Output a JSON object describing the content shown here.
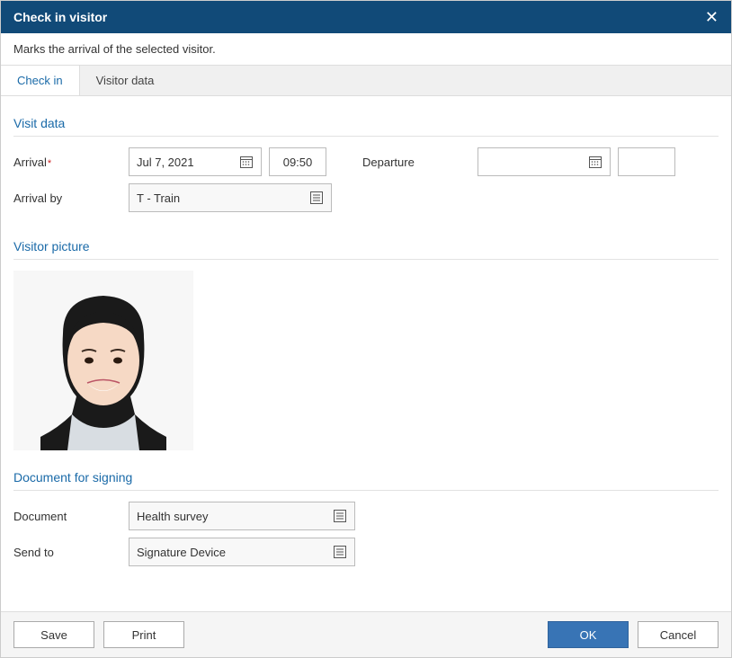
{
  "dialog": {
    "title": "Check in visitor",
    "subtitle": "Marks the arrival of the selected visitor."
  },
  "tabs": [
    {
      "label": "Check in",
      "active": true
    },
    {
      "label": "Visitor data",
      "active": false
    }
  ],
  "sections": {
    "visit_data": {
      "title": "Visit data"
    },
    "visitor_picture": {
      "title": "Visitor picture"
    },
    "document_signing": {
      "title": "Document for signing"
    }
  },
  "fields": {
    "arrival": {
      "label": "Arrival",
      "required": true,
      "date": "Jul 7, 2021",
      "time": "09:50"
    },
    "departure": {
      "label": "Departure",
      "date": "",
      "time": ""
    },
    "arrival_by": {
      "label": "Arrival by",
      "value": "T - Train"
    },
    "document": {
      "label": "Document",
      "value": "Health survey"
    },
    "send_to": {
      "label": "Send to",
      "value": "Signature Device"
    }
  },
  "buttons": {
    "save": "Save",
    "print": "Print",
    "ok": "OK",
    "cancel": "Cancel"
  }
}
